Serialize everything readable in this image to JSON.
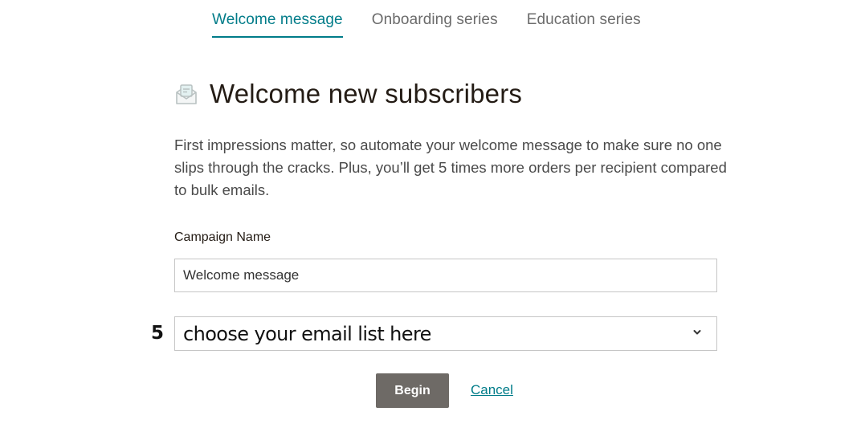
{
  "tabs": [
    {
      "label": "Welcome message",
      "active": true
    },
    {
      "label": "Onboarding series",
      "active": false
    },
    {
      "label": "Education series",
      "active": false
    }
  ],
  "header": {
    "icon": "envelope-open-icon",
    "title": "Welcome new subscribers"
  },
  "description": "First impressions matter, so automate your welcome message to make sure no one slips through the cracks. Plus, you’ll get 5 times more orders per recipient compared to bulk emails.",
  "form": {
    "campaign_name_label": "Campaign Name",
    "campaign_name_value": "Welcome message",
    "step_number": "5",
    "list_select_value": "choose your email list here",
    "list_select_icon": "chevron-down-icon"
  },
  "actions": {
    "begin_label": "Begin",
    "cancel_label": "Cancel"
  },
  "colors": {
    "accent": "#007c89",
    "button_bg": "#6e6a66",
    "text": "#241c15"
  }
}
